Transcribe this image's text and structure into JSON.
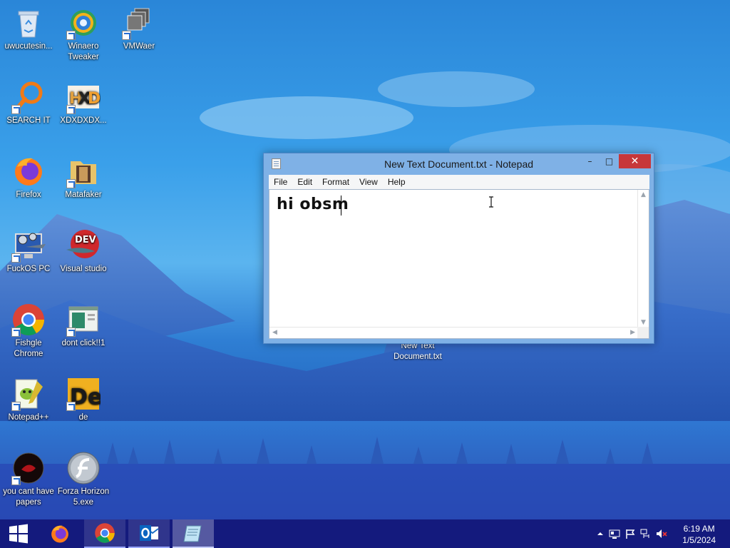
{
  "desktop": {
    "icons": [
      {
        "label": "uwucutesin...",
        "icon": "recycle-bin-icon"
      },
      {
        "label": "Winaero Tweaker",
        "icon": "winaero-tweaker-icon"
      },
      {
        "label": "VMWaer",
        "icon": "vmware-icon"
      },
      {
        "label": "SEARCH IT",
        "icon": "magnifier-icon"
      },
      {
        "label": "XDXDXDX...",
        "icon": "hxd-icon"
      },
      {
        "label": "Firefox",
        "icon": "firefox-icon"
      },
      {
        "label": "Matafaker",
        "icon": "folder-icon"
      },
      {
        "label": "FuckOS PC",
        "icon": "computer-gear-icon"
      },
      {
        "label": "Visual studio",
        "icon": "dev-icon"
      },
      {
        "label": "Fishgle Chrome",
        "icon": "chrome-icon"
      },
      {
        "label": "dont click!!1",
        "icon": "app-window-icon"
      },
      {
        "label": "Notepad++",
        "icon": "notepad-plus-plus-icon"
      },
      {
        "label": "de",
        "icon": "de-icon"
      },
      {
        "label": "you cant have papers",
        "icon": "dark-disc-icon"
      },
      {
        "label": "Forza Horizon 5.exe",
        "icon": "flash-icon"
      }
    ],
    "ghost_file": "New Text Document.txt"
  },
  "notepad": {
    "title": "New Text Document.txt - Notepad",
    "menu": [
      "File",
      "Edit",
      "Format",
      "View",
      "Help"
    ],
    "content": "hi obsm",
    "minimize": "–",
    "maximize": "□",
    "close": "✕"
  },
  "taskbar": {
    "pinned": [
      "start-icon",
      "firefox-icon",
      "chrome-icon",
      "outlook-icon",
      "notepad-icon"
    ],
    "tray": [
      "chevron-up-icon",
      "network-icon",
      "flag-icon",
      "ethernet-icon",
      "volume-muted-icon"
    ],
    "clock": {
      "time": "6:19 AM",
      "date": "1/5/2024"
    }
  },
  "colors": {
    "taskbar": "#141a7d",
    "close_button": "#c7373a",
    "window_frame": "#7fb1e6"
  }
}
